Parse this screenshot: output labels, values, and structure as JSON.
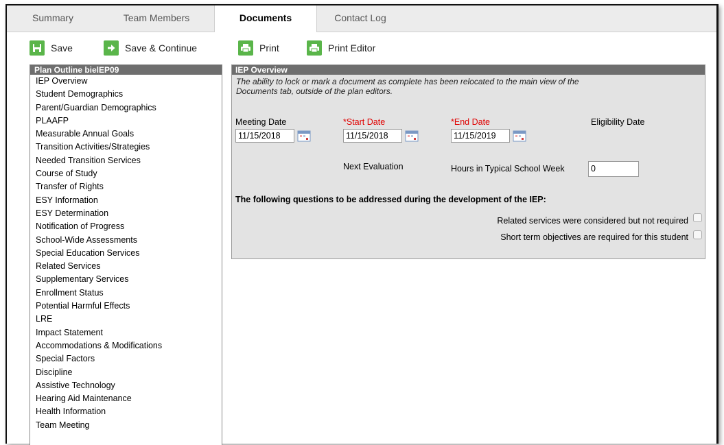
{
  "tabs": [
    {
      "label": "Summary",
      "active": false
    },
    {
      "label": "Team Members",
      "active": false
    },
    {
      "label": "Documents",
      "active": true
    },
    {
      "label": "Contact Log",
      "active": false
    }
  ],
  "toolbar": {
    "save_label": "Save",
    "save_continue_label": "Save & Continue",
    "print_label": "Print",
    "print_editor_label": "Print Editor"
  },
  "outline": {
    "header": "Plan Outline bielEP09",
    "items": [
      "IEP Overview",
      "Student Demographics",
      "Parent/Guardian Demographics",
      "PLAAFP",
      "Measurable Annual Goals",
      "Transition Activities/Strategies",
      "Needed Transition Services",
      "Course of Study",
      "Transfer of Rights",
      "ESY Information",
      "ESY Determination",
      "Notification of Progress",
      "School-Wide Assessments",
      "Special Education Services",
      "Related Services",
      "Supplementary Services",
      "Enrollment Status",
      "Potential Harmful Effects",
      "LRE",
      "Impact Statement",
      "Accommodations & Modifications",
      "Special Factors",
      "Discipline",
      "Assistive Technology",
      "Hearing Aid Maintenance",
      "Health Information",
      "Team Meeting"
    ]
  },
  "overview": {
    "header": "IEP Overview",
    "notice_line1": "The ability to lock or mark a document as complete has been relocated to the main view of the",
    "notice_line2": "Documents tab, outside of the plan editors.",
    "meeting_date_label": "Meeting Date",
    "meeting_date_value": "11/15/2018",
    "start_date_label": "Start Date",
    "start_date_value": "11/15/2018",
    "end_date_label": "End Date",
    "end_date_value": "11/15/2019",
    "required_marker": "*",
    "eligibility_date_label": "Eligibility Date",
    "next_evaluation_label": "Next Evaluation",
    "hours_label": "Hours in Typical School Week",
    "hours_value": "0",
    "questions_heading": "The following questions to be addressed during the development of the IEP:",
    "question1": "Related services were considered but not required",
    "question2": "Short term objectives are required for this student"
  },
  "colors": {
    "accent_green": "#5ab54a",
    "header_gray": "#6e6e6e",
    "panel_bg": "#e3e3e3",
    "required_red": "#e00000"
  },
  "icons": {
    "save": "floppy-icon",
    "save_continue": "arrow-right-icon",
    "print": "printer-icon",
    "calendar": "calendar-icon"
  }
}
